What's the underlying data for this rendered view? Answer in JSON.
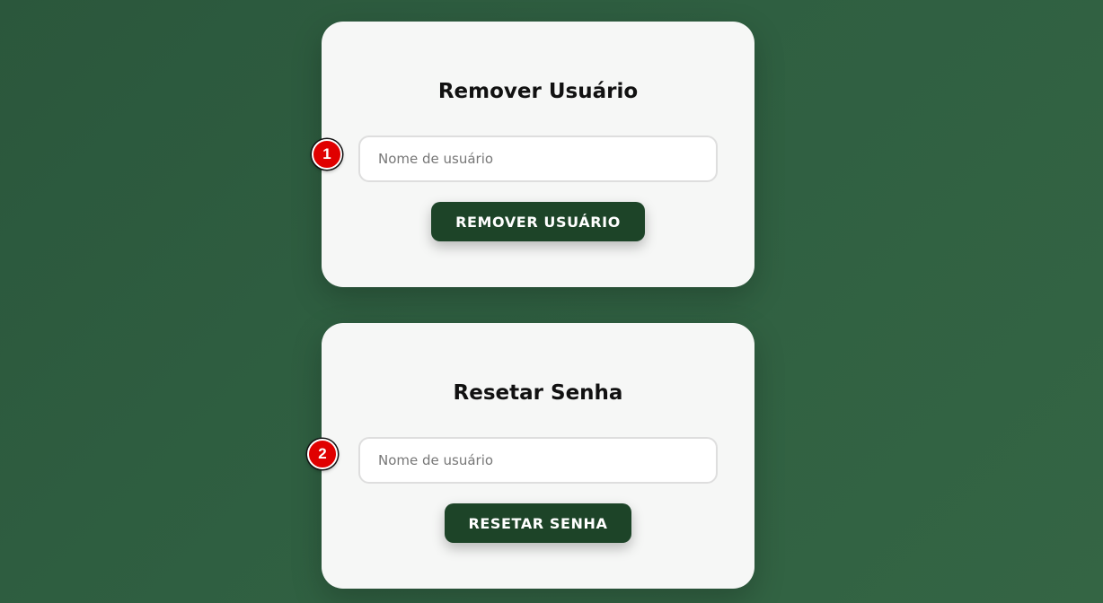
{
  "remove_user": {
    "title": "Remover Usuário",
    "username_placeholder": "Nome de usuário",
    "username_value": "",
    "button_label": "REMOVER USUÁRIO"
  },
  "reset_password": {
    "title": "Resetar Senha",
    "username_placeholder": "Nome de usuário",
    "username_value": "",
    "button_label": "RESETAR SENHA"
  },
  "markers": [
    "1",
    "2"
  ],
  "colors": {
    "background": "#2f5f41",
    "card": "#f6f7f6",
    "button": "#1d4428",
    "marker": "#e00000"
  }
}
